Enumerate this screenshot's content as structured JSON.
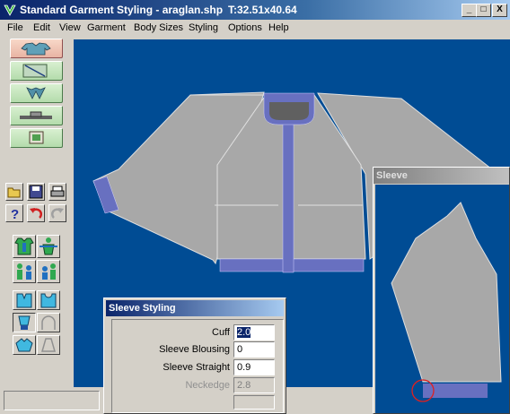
{
  "window": {
    "title": "Standard Garment Styling - araglan.shp",
    "coords": "T:32.51x40.64",
    "controls": [
      "_",
      "□",
      "X"
    ]
  },
  "menu": [
    "File",
    "Edit",
    "View",
    "Garment",
    "Body Sizes",
    "Styling",
    "Options",
    "Help"
  ],
  "icons": {
    "top_toolbar": [
      "grid-select-icon",
      "shirt-outline-icon",
      "shirt-neck-icon",
      "dash-icon",
      "ruler-icon"
    ],
    "left_toolbar": [
      "sweater-icon",
      "pattern-chart-icon",
      "collar-icon",
      "sleeve-tool-icon",
      "picture-icon",
      "open-folder-icon",
      "save-disk-icon",
      "print-icon",
      "help-icon",
      "undo-icon",
      "redo-icon",
      "garment-front-icon",
      "garment-measure-icon",
      "family-sizes-icon",
      "child-sizes-icon",
      "neckline-v-icon",
      "neckline-round-icon",
      "cuff-icon",
      "sleeve-cap-icon",
      "shoulder-icon",
      "trapezoid-icon"
    ]
  },
  "colors": {
    "canvas": "#004c94",
    "garment": "#a8a8a8",
    "trim": "#6870c0"
  },
  "sleeve_window": {
    "title": "Sleeve"
  },
  "styling_dialog": {
    "title": "Sleeve Styling",
    "fields": [
      {
        "label": "Cuff",
        "value": "2.0",
        "enabled": true,
        "selected": true
      },
      {
        "label": "Sleeve Blousing",
        "value": "0",
        "enabled": true,
        "selected": false
      },
      {
        "label": "Sleeve Straight",
        "value": "0.9",
        "enabled": true,
        "selected": false
      },
      {
        "label": "Neckedge",
        "value": "2.8",
        "enabled": false,
        "selected": false
      }
    ]
  }
}
